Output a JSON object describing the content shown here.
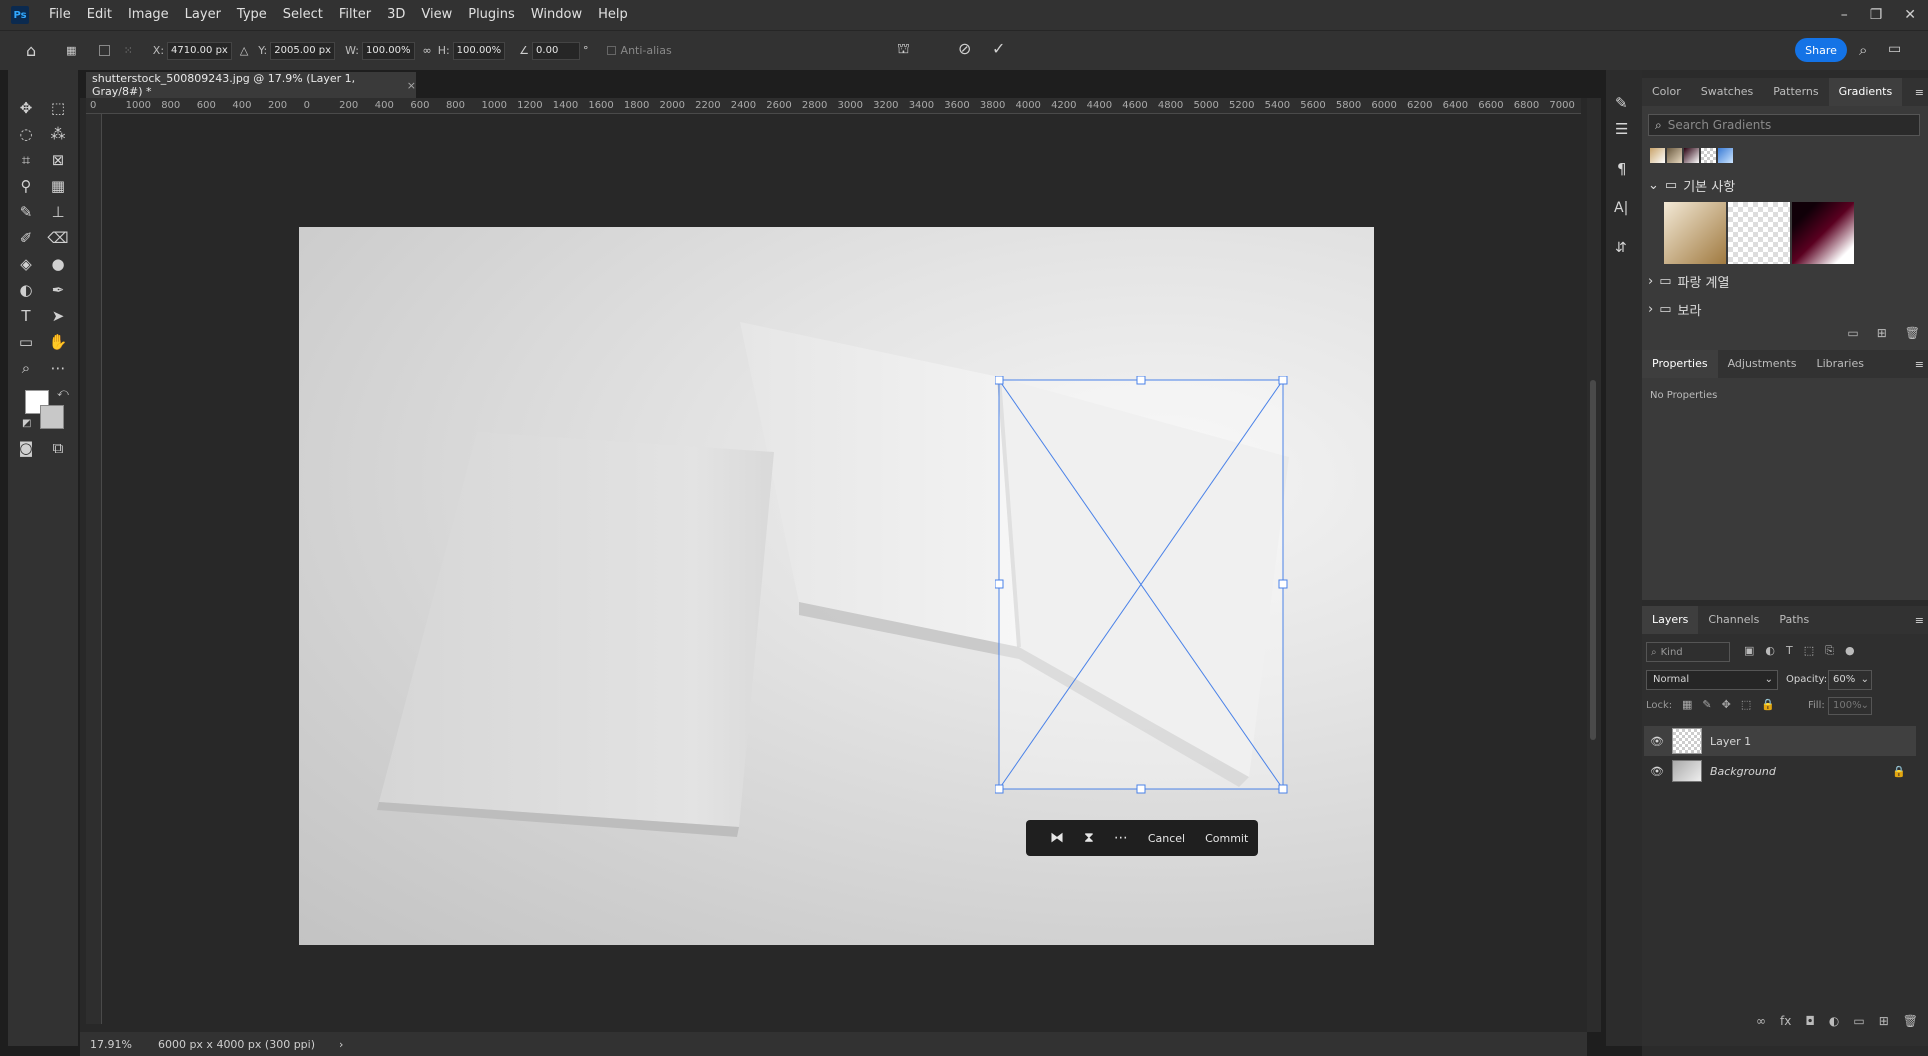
{
  "app": {
    "logo": "Ps"
  },
  "menus": [
    "File",
    "Edit",
    "Image",
    "Layer",
    "Type",
    "Select",
    "Filter",
    "3D",
    "View",
    "Plugins",
    "Window",
    "Help"
  ],
  "window_controls": {
    "minimize": "–",
    "restore": "❐",
    "close": "✕"
  },
  "options": {
    "x_label": "X:",
    "x_value": "4710.00 px",
    "y_label": "Y:",
    "y_value": "2005.00 px",
    "w_label": "W:",
    "w_value": "100.00%",
    "h_label": "H:",
    "h_value": "100.00%",
    "angle_value": "0.00",
    "angle_unit": "°",
    "antialias": "Anti-alias",
    "share": "Share"
  },
  "document": {
    "tab_title": "shutterstock_500809243.jpg @ 17.9% (Layer 1, Gray/8#) *",
    "ruler_labels": [
      "0",
      "1000",
      "800",
      "600",
      "400",
      "200",
      "0",
      "200",
      "400",
      "600",
      "800",
      "1000",
      "1200",
      "1400",
      "1600",
      "1800",
      "2000",
      "2200",
      "2400",
      "2600",
      "2800",
      "3000",
      "3200",
      "3400",
      "3600",
      "3800",
      "4000",
      "4200",
      "4400",
      "4600",
      "4800",
      "5000",
      "5200",
      "5400",
      "5600",
      "5800",
      "6000",
      "6200",
      "6400",
      "6600",
      "6800",
      "7000"
    ]
  },
  "status": {
    "zoom": "17.91%",
    "info": "6000 px x 4000 px (300 ppi)"
  },
  "taskbar": {
    "cancel": "Cancel",
    "commit": "Commit"
  },
  "panels": {
    "top_tabs": [
      "Color",
      "Swatches",
      "Patterns",
      "Gradients"
    ],
    "search_placeholder": "Search Gradients",
    "folders": [
      "기본 사항",
      "파랑 계열",
      "보라"
    ],
    "props_tabs": [
      "Properties",
      "Adjustments",
      "Libraries"
    ],
    "no_properties": "No Properties",
    "layer_tabs": [
      "Layers",
      "Channels",
      "Paths"
    ],
    "kind": "Kind",
    "blend_mode": "Normal",
    "opacity_label": "Opacity:",
    "opacity_value": "60%",
    "lock_label": "Lock:",
    "fill_label": "Fill:",
    "fill_value": "100%",
    "layers": [
      {
        "name": "Layer 1"
      },
      {
        "name": "Background"
      }
    ]
  },
  "colors": {
    "accent": "#1473e6",
    "transform_line": "#4a82e8"
  }
}
